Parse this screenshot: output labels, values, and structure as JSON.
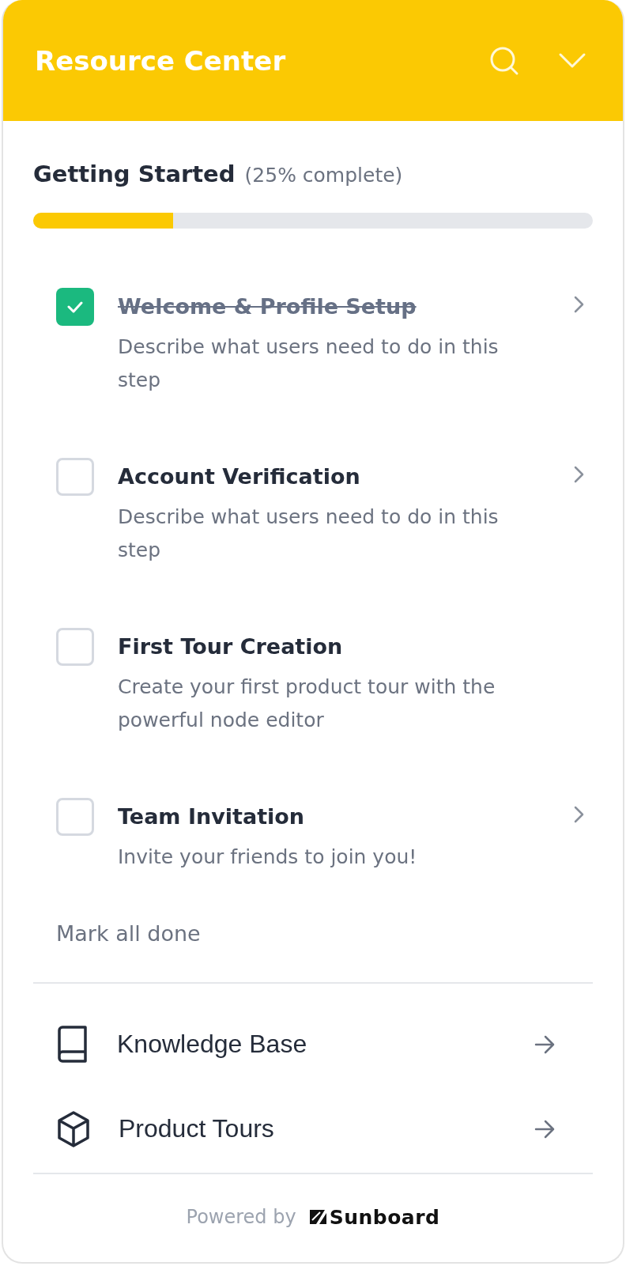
{
  "header": {
    "title": "Resource Center"
  },
  "checklist": {
    "title": "Getting Started",
    "progress_text": "(25% complete)",
    "level": 0.25,
    "steps": [
      {
        "title": "Welcome & Profile Setup",
        "description": "Describe what users need to do in this step",
        "checked": true,
        "chevron": true
      },
      {
        "title": "Account Verification",
        "description": "Describe what users need to do in this step",
        "checked": false,
        "chevron": true
      },
      {
        "title": "First Tour Creation",
        "description": "Create your first product tour with the powerful node editor",
        "checked": false,
        "chevron": false
      },
      {
        "title": "Team Invitation",
        "description": "Invite your friends to join you!",
        "checked": false,
        "chevron": true
      }
    ],
    "mark_all": "Mark all done"
  },
  "links": [
    {
      "kind": "book",
      "label": "Knowledge Base"
    },
    {
      "kind": "cube",
      "label": "Product Tours"
    }
  ],
  "footer": {
    "powered_by": "Powered by",
    "brand": "Sunboard"
  }
}
